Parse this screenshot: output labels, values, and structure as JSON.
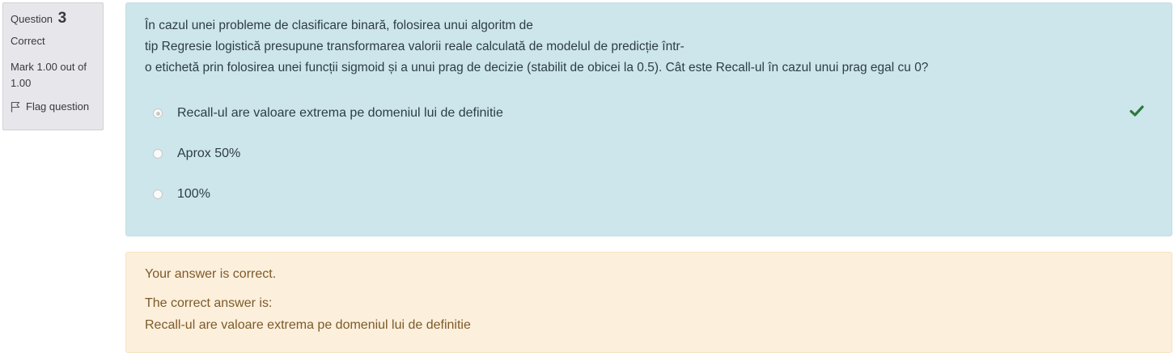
{
  "info": {
    "question_label": "Question",
    "question_number": "3",
    "state": "Correct",
    "grade_line1": "Mark 1.00 out of",
    "grade_line2": "1.00",
    "flag_label": "Flag question"
  },
  "question": {
    "text_lines": [
      "În cazul unei probleme de clasificare binară, folosirea unui algoritm de",
      "tip Regresie logistică presupune transformarea valorii reale calculată de modelul de predicție într-",
      "o etichetă prin folosirea unei funcții sigmoid și a unui prag de decizie (stabilit de obicei la 0.5). Cât este Recall-ul în cazul unui prag egal cu 0?"
    ],
    "answers": [
      {
        "label": "Recall-ul are valoare extrema pe domeniul lui de definitie",
        "selected": true,
        "correct": true
      },
      {
        "label": "Aprox 50%",
        "selected": false
      },
      {
        "label": "100%",
        "selected": false
      }
    ]
  },
  "feedback": {
    "status": "Your answer is correct.",
    "correct_intro": "The correct answer is:",
    "correct_answer": "Recall-ul are valoare extrema pe domeniul lui de definitie"
  },
  "colors": {
    "formulation_bg": "#cde6eb",
    "feedback_bg": "#fcefdc",
    "info_bg": "#e7e7eb",
    "correct_check": "#2b7a3d"
  },
  "icons": {
    "flag": "flag-icon",
    "correct": "check-icon"
  }
}
